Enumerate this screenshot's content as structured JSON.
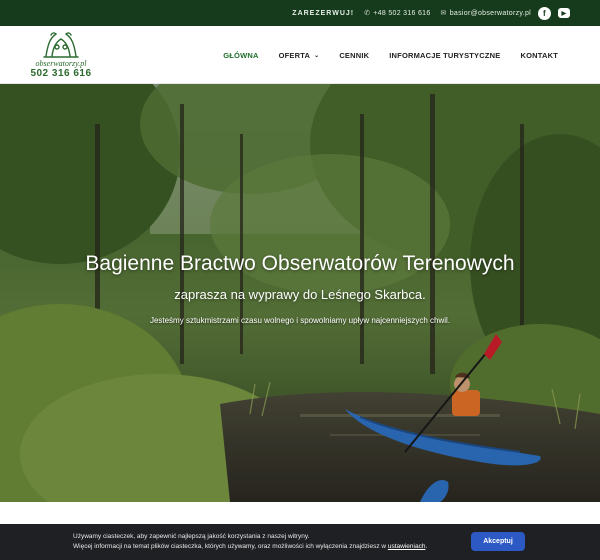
{
  "topbar": {
    "cta": "ZAREZERWUJ!",
    "phone": "+48 502 316 616",
    "email": "basior@obserwatorzy.pl",
    "phone_icon": "phone-icon",
    "email_icon": "envelope-icon",
    "socials": [
      {
        "name": "facebook-icon",
        "glyph": "f"
      },
      {
        "name": "youtube-icon",
        "glyph": "▶"
      }
    ]
  },
  "logo": {
    "site": "obserwatorzy.pl",
    "phone": "502 316 616"
  },
  "nav": {
    "items": [
      {
        "label": "GŁÓWNA",
        "active": true
      },
      {
        "label": "OFERTA",
        "has_dropdown": true
      },
      {
        "label": "CENNIK"
      },
      {
        "label": "INFORMACJE TURYSTYCZNE"
      },
      {
        "label": "KONTAKT"
      }
    ]
  },
  "hero": {
    "title": "Bagienne Bractwo Obserwatorów Terenowych",
    "subtitle": "zaprasza na wyprawy do Leśnego Skarbca.",
    "description": "Jesteśmy sztukmistrzami czasu wolnego i spowolniamy upływ najcenniejszych chwil."
  },
  "cookie": {
    "line1": "Używamy ciasteczek, aby zapewnić najlepszą jakość korzystania z naszej witryny.",
    "line2_prefix": "Więcej informacji na temat plików ciasteczka, których używamy, oraz możliwości ich wyłączenia znajdziesz w ",
    "link": "ustawieniach",
    "line2_suffix": ".",
    "accept": "Akceptuj"
  },
  "colors": {
    "topbar": "#163b1c",
    "nav_active": "#1f6f2c",
    "accept_button": "#2c59c4",
    "cookie_bg": "#1f2023"
  }
}
